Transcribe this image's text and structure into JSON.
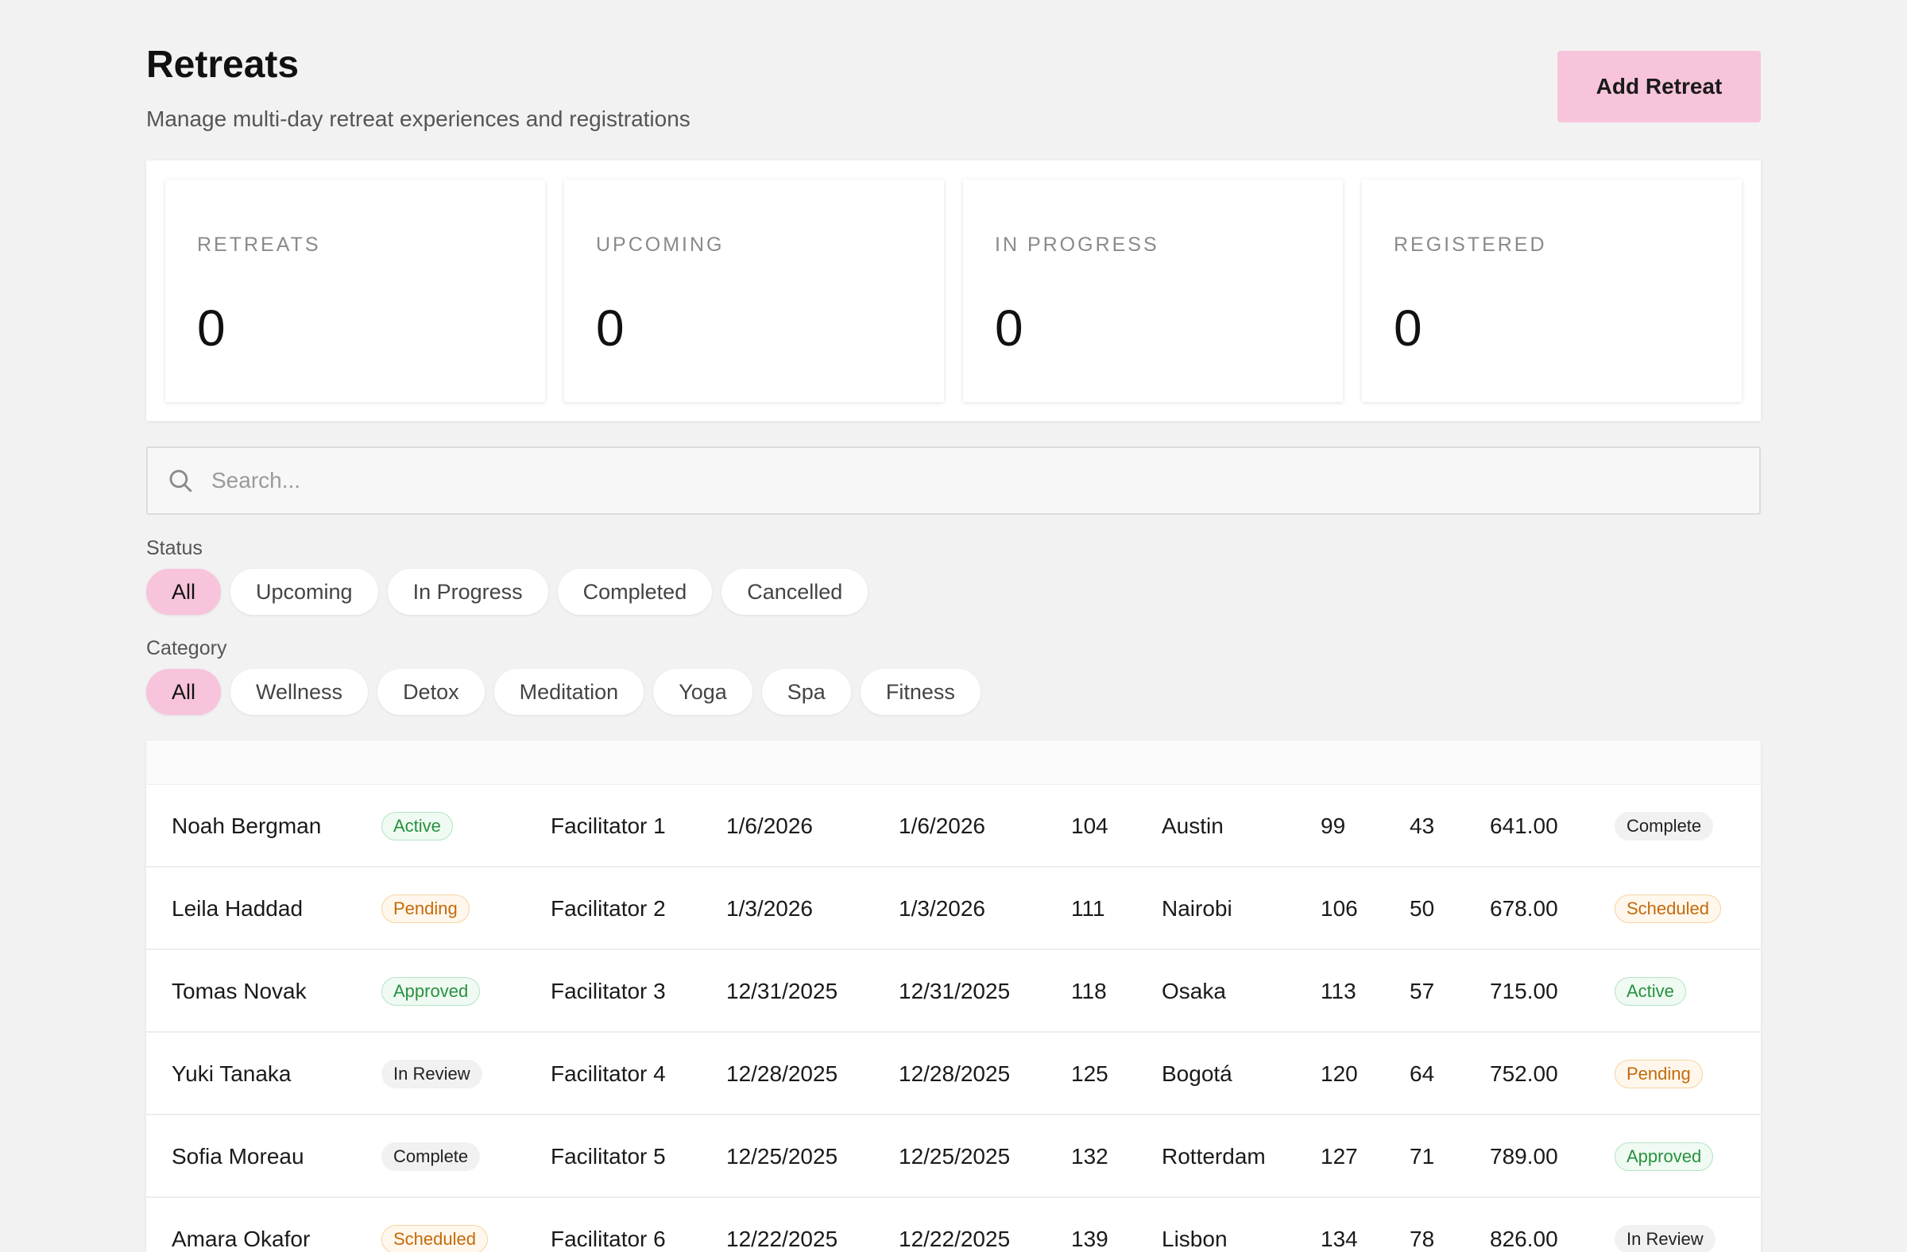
{
  "header": {
    "title": "Retreats",
    "subtitle": "Manage multi-day retreat experiences and registrations",
    "add_button": "Add Retreat"
  },
  "stats": [
    {
      "label": "RETREATS",
      "value": "0"
    },
    {
      "label": "UPCOMING",
      "value": "0"
    },
    {
      "label": "IN PROGRESS",
      "value": "0"
    },
    {
      "label": "REGISTERED",
      "value": "0"
    }
  ],
  "search": {
    "placeholder": "Search...",
    "icon": "search-icon"
  },
  "status_filter": {
    "label": "Status",
    "options": [
      "All",
      "Upcoming",
      "In Progress",
      "Completed",
      "Cancelled"
    ],
    "selected": "All"
  },
  "category_filter": {
    "label": "Category",
    "options": [
      "All",
      "Wellness",
      "Detox",
      "Meditation",
      "Yoga",
      "Spa",
      "Fitness"
    ],
    "selected": "All"
  },
  "colors": {
    "accent": "#f7c4db",
    "badge_green": "#27913f",
    "badge_orange": "#c46a0b",
    "badge_gray": "#222222"
  },
  "rows": [
    {
      "name": "Noah Bergman",
      "status": "Active",
      "facilitator": "Facilitator 1",
      "start": "1/6/2026",
      "end": "1/6/2026",
      "n1": "104",
      "city": "Austin",
      "n2": "99",
      "n3": "43",
      "amount": "641.00",
      "state": "Complete"
    },
    {
      "name": "Leila Haddad",
      "status": "Pending",
      "facilitator": "Facilitator 2",
      "start": "1/3/2026",
      "end": "1/3/2026",
      "n1": "111",
      "city": "Nairobi",
      "n2": "106",
      "n3": "50",
      "amount": "678.00",
      "state": "Scheduled"
    },
    {
      "name": "Tomas Novak",
      "status": "Approved",
      "facilitator": "Facilitator 3",
      "start": "12/31/2025",
      "end": "12/31/2025",
      "n1": "118",
      "city": "Osaka",
      "n2": "113",
      "n3": "57",
      "amount": "715.00",
      "state": "Active"
    },
    {
      "name": "Yuki Tanaka",
      "status": "In Review",
      "facilitator": "Facilitator 4",
      "start": "12/28/2025",
      "end": "12/28/2025",
      "n1": "125",
      "city": "Bogotá",
      "n2": "120",
      "n3": "64",
      "amount": "752.00",
      "state": "Pending"
    },
    {
      "name": "Sofia Moreau",
      "status": "Complete",
      "facilitator": "Facilitator 5",
      "start": "12/25/2025",
      "end": "12/25/2025",
      "n1": "132",
      "city": "Rotterdam",
      "n2": "127",
      "n3": "71",
      "amount": "789.00",
      "state": "Approved"
    },
    {
      "name": "Amara Okafor",
      "status": "Scheduled",
      "facilitator": "Facilitator 6",
      "start": "12/22/2025",
      "end": "12/22/2025",
      "n1": "139",
      "city": "Lisbon",
      "n2": "134",
      "n3": "78",
      "amount": "826.00",
      "state": "In Review"
    }
  ]
}
